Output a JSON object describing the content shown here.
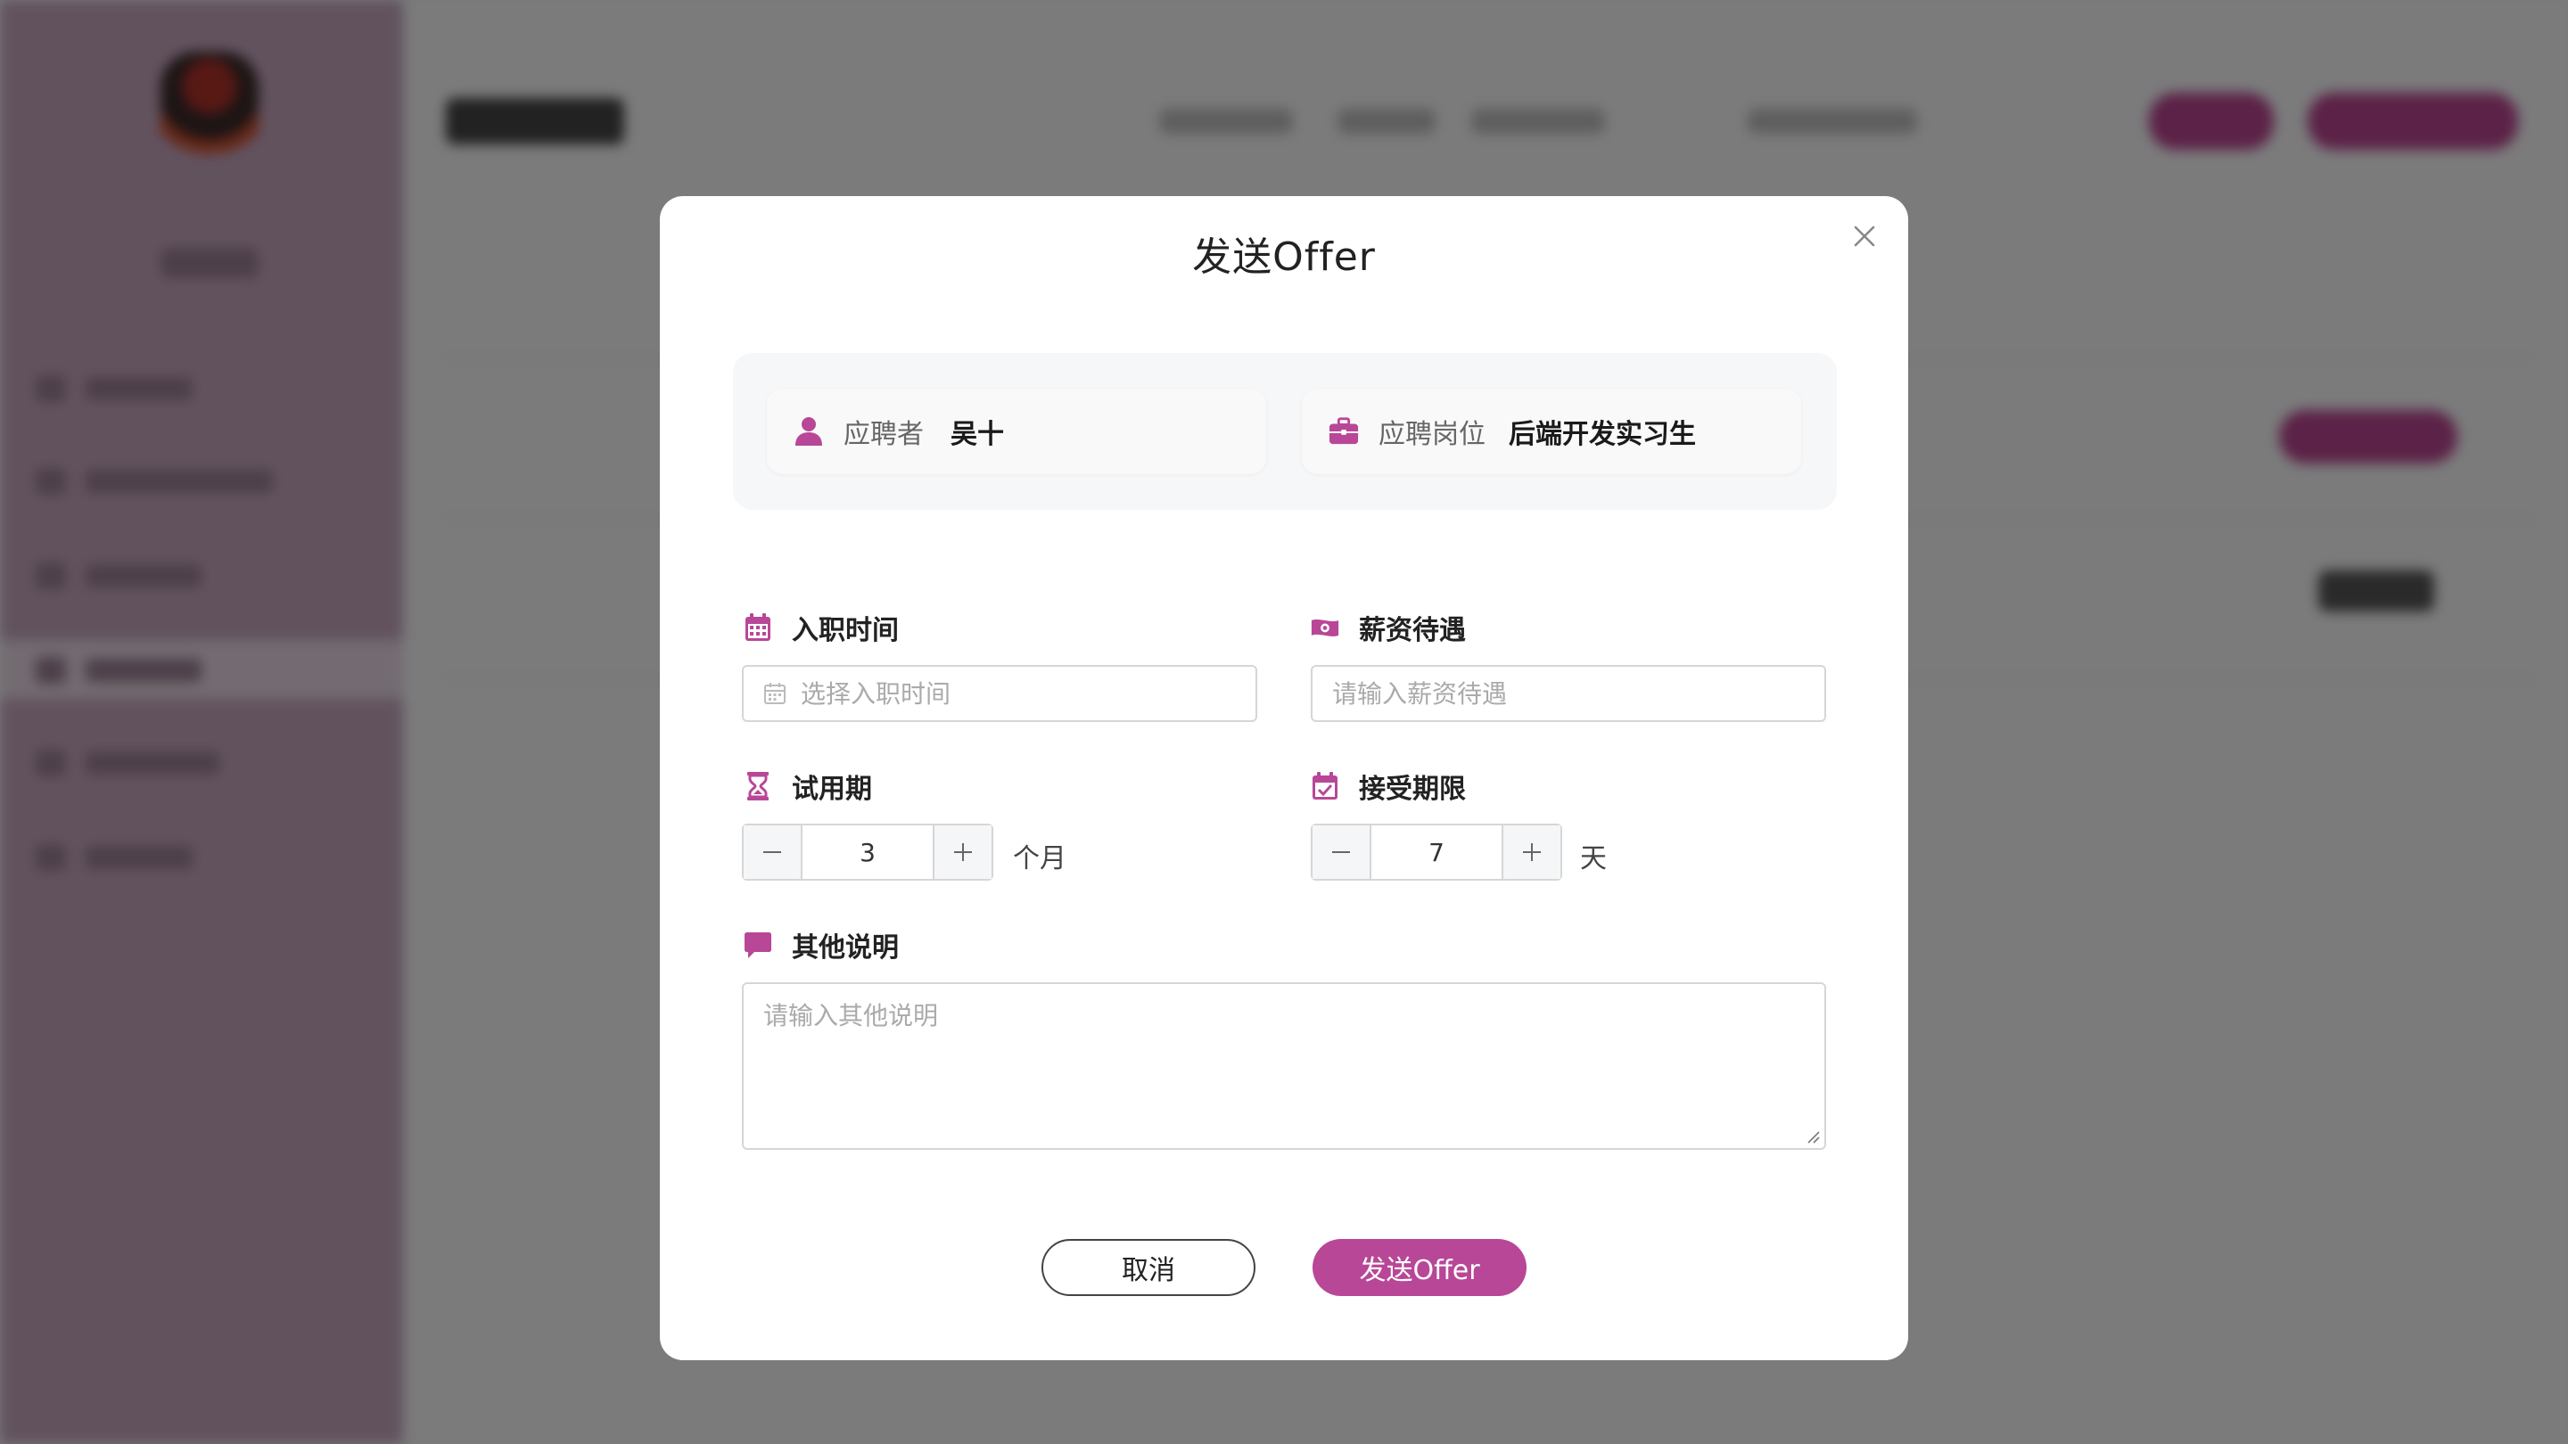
{
  "colors": {
    "accent": "#b84797",
    "overlay": "rgba(0,0,0,0.5)"
  },
  "modal": {
    "title": "发送Offer",
    "close_icon": "close-icon",
    "applicant": {
      "label": "应聘者",
      "value": "吴十",
      "icon": "user-icon"
    },
    "position": {
      "label": "应聘岗位",
      "value": "后端开发实习生",
      "icon": "briefcase-icon"
    },
    "start_date": {
      "label": "入职时间",
      "placeholder": "选择入职时间",
      "icon": "calendar-icon"
    },
    "salary": {
      "label": "薪资待遇",
      "placeholder": "请输入薪资待遇",
      "icon": "money-icon"
    },
    "probation": {
      "label": "试用期",
      "value": "3",
      "unit": "个月",
      "icon": "hourglass-icon"
    },
    "deadline": {
      "label": "接受期限",
      "value": "7",
      "unit": "天",
      "icon": "calendar-check-icon"
    },
    "notes": {
      "label": "其他说明",
      "placeholder": "请输入其他说明",
      "icon": "comment-icon"
    },
    "cancel_label": "取消",
    "send_label": "发送Offer"
  }
}
